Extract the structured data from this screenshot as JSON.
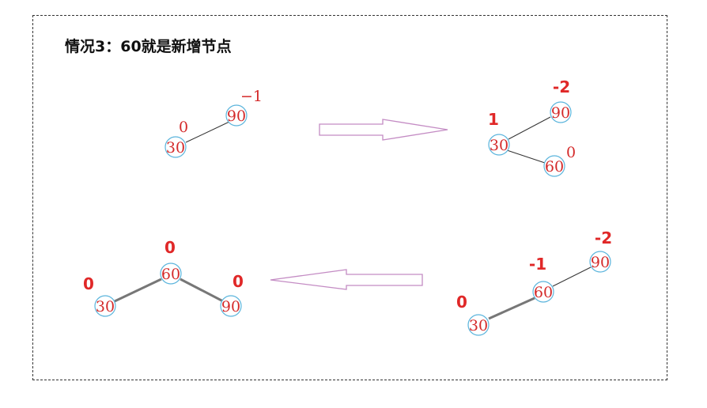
{
  "title": "情况3：60就是新增节点",
  "nodes": {
    "d1_90": "90",
    "d1_30": "30",
    "d2_90": "90",
    "d2_30": "30",
    "d2_60": "60",
    "d3_90": "90",
    "d3_60": "60",
    "d3_30": "30",
    "d4_60": "60",
    "d4_30": "30",
    "d4_90": "90"
  },
  "balance": {
    "d1_90": "−1",
    "d1_30": "0",
    "d2_90": "-2",
    "d2_30": "1",
    "d2_60": "0",
    "d3_90": "-2",
    "d3_60": "-1",
    "d3_30": "0",
    "d4_60": "0",
    "d4_30": "0",
    "d4_90": "0"
  },
  "colors": {
    "node_text": "#d42a2a",
    "node_ring": "#5ab4dc",
    "arrow_outline": "#c48cc4"
  }
}
